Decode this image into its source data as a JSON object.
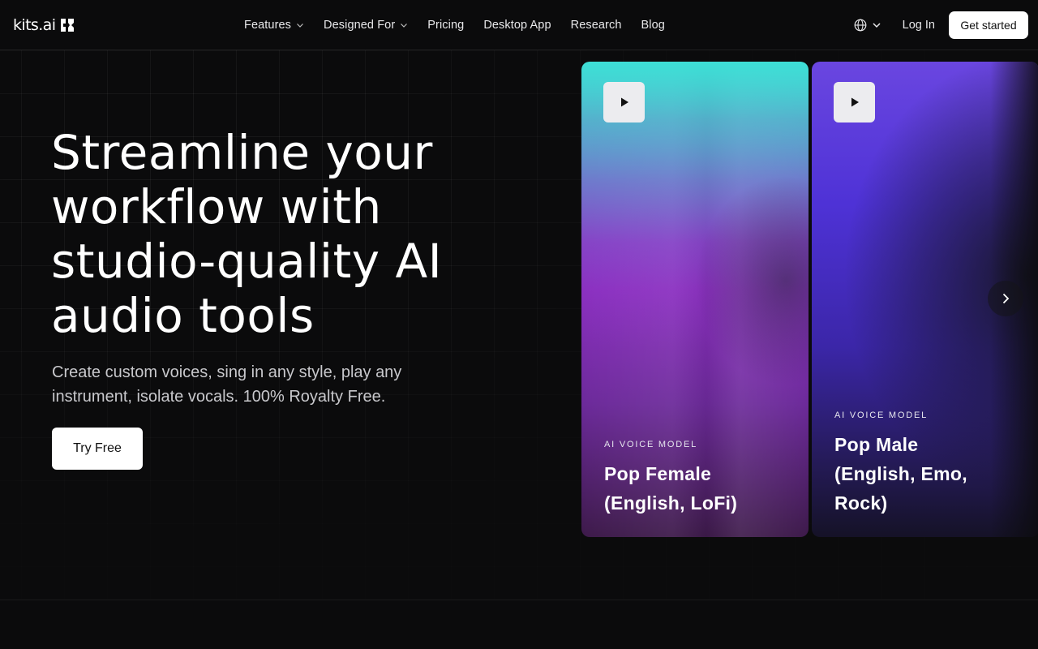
{
  "header": {
    "logo_text": "kits.ai",
    "nav": [
      {
        "label": "Features",
        "has_dropdown": true
      },
      {
        "label": "Designed For",
        "has_dropdown": true
      },
      {
        "label": "Pricing",
        "has_dropdown": false
      },
      {
        "label": "Desktop App",
        "has_dropdown": false
      },
      {
        "label": "Research",
        "has_dropdown": false
      },
      {
        "label": "Blog",
        "has_dropdown": false
      }
    ],
    "language_icon": "globe-icon",
    "login_label": "Log In",
    "cta_label": "Get started"
  },
  "hero": {
    "title": "Streamline your workflow with studio-quality AI audio tools",
    "subtitle": "Create custom voices, sing in any style, play any instrument, isolate vocals. 100% Royalty Free.",
    "cta_label": "Try Free"
  },
  "cards": [
    {
      "tag": "AI VOICE MODEL",
      "name": "Pop Female (English, LoFi)",
      "play_icon": "play-icon"
    },
    {
      "tag": "AI VOICE MODEL",
      "name": "Pop Male (English, Emo, Rock)",
      "play_icon": "play-icon"
    }
  ],
  "colors": {
    "background": "#0b0b0c",
    "button_bg": "#ffffff",
    "card1_top": "#4dd6d8",
    "card1_mid": "#8b2fc0",
    "card2_top": "#6a46e0"
  }
}
